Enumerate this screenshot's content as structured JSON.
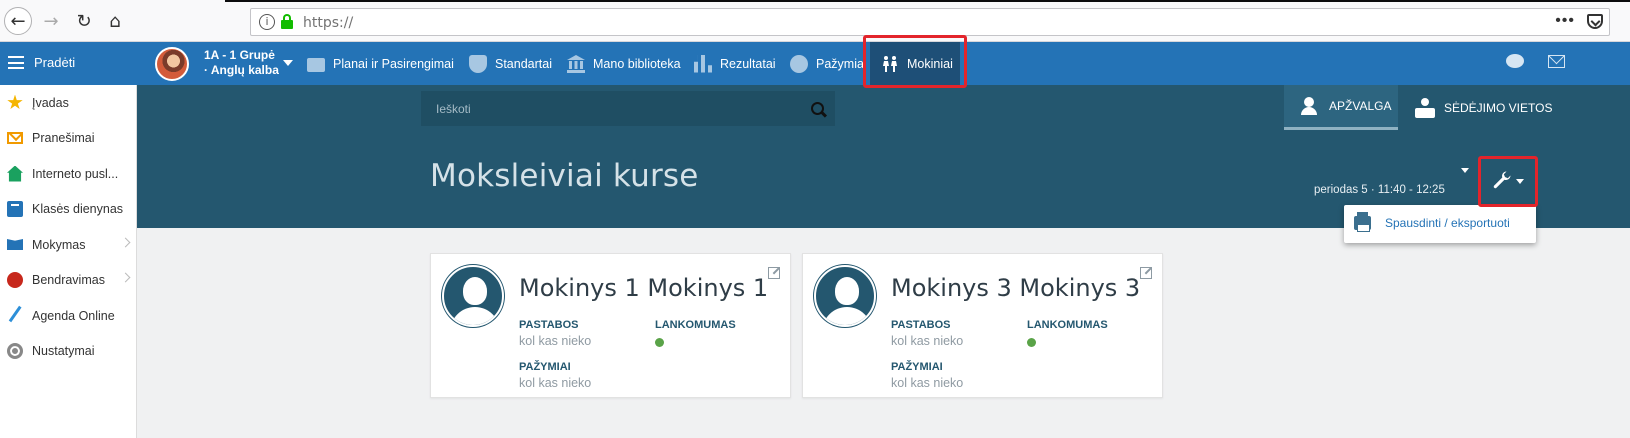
{
  "browser": {
    "url": "https://",
    "menu_dots": "•••"
  },
  "topnav": {
    "start_label": "Pradėti",
    "class_line1": "1A - 1 Grupė",
    "class_line2": "· Anglų kalba",
    "items": [
      {
        "label": "Planai ir Pasirengimai",
        "icon": "briefcase-icon"
      },
      {
        "label": "Standartai",
        "icon": "shield-icon"
      },
      {
        "label": "Mano biblioteka",
        "icon": "library-icon"
      },
      {
        "label": "Rezultatai",
        "icon": "bar-chart-icon"
      },
      {
        "label": "Pažymiai",
        "icon": "grade-icon"
      },
      {
        "label": "Mokiniai",
        "icon": "students-icon"
      }
    ],
    "active_item": "Mokiniai"
  },
  "sidebar": {
    "items": [
      {
        "label": "Įvadas",
        "icon": "star-icon",
        "color": "#f5b500"
      },
      {
        "label": "Pranešimai",
        "icon": "envelope-icon",
        "color": "#f19a00"
      },
      {
        "label": "Interneto pusl...",
        "icon": "home-icon",
        "color": "#1aa15f"
      },
      {
        "label": "Klasės dienynas",
        "icon": "notebook-icon",
        "color": "#2473b6"
      },
      {
        "label": "Mokymas",
        "icon": "open-book-icon",
        "color": "#2473b6",
        "has_submenu": true
      },
      {
        "label": "Bendravimas",
        "icon": "speech-bubble-icon",
        "color": "#c7281c",
        "has_submenu": true
      },
      {
        "label": "Agenda Online",
        "icon": "pen-icon",
        "color": "#2d8fd8"
      },
      {
        "label": "Nustatymai",
        "icon": "gear-icon",
        "color": "#888888"
      }
    ]
  },
  "header": {
    "search_placeholder": "Ieškoti",
    "title": "Moksleiviai kurse",
    "period": "periodas 5 · 11:40 - 12:25",
    "tabs": [
      {
        "label": "Apžvalga",
        "active": true
      },
      {
        "label": "Sėdėjimo vietos",
        "active": false
      }
    ]
  },
  "dropdown": {
    "items": [
      {
        "label": "Spausdinti / eksportuoti",
        "icon": "printer-icon"
      }
    ]
  },
  "cards": [
    {
      "name": "Mokinys 1 Mokinys 1",
      "notes_label": "PASTABOS",
      "notes_value": "kol kas nieko",
      "attendance_label": "LANKOMUMAS",
      "attendance_status_color": "#5aa348",
      "grades_label": "PAŽYMIAI",
      "grades_value": "kol kas nieko"
    },
    {
      "name": "Mokinys 3 Mokinys 3",
      "notes_label": "PASTABOS",
      "notes_value": "kol kas nieko",
      "attendance_label": "LANKOMUMAS",
      "attendance_status_color": "#5aa348",
      "grades_label": "PAŽYMIAI",
      "grades_value": "kol kas nieko"
    }
  ],
  "colors": {
    "topnav_bg": "#2473b6",
    "header_bg": "#24576f",
    "highlight": "#e3242b"
  }
}
